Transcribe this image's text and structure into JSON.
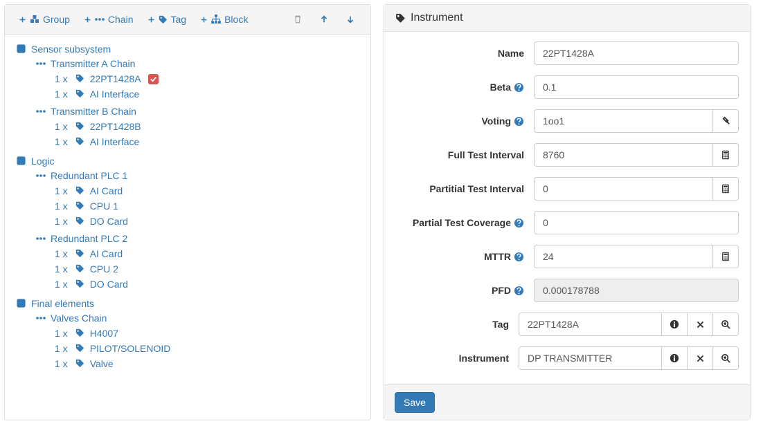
{
  "toolbar": {
    "group": "Group",
    "chain": "Chain",
    "tag": "Tag",
    "block": "Block"
  },
  "tree": {
    "groups": [
      {
        "label": "Sensor subsystem",
        "chains": [
          {
            "label": "Transmitter A Chain",
            "items": [
              {
                "qty": "1 x",
                "label": "22PT1428A",
                "selected": true
              },
              {
                "qty": "1 x",
                "label": "AI Interface"
              }
            ]
          },
          {
            "label": "Transmitter B Chain",
            "items": [
              {
                "qty": "1 x",
                "label": "22PT1428B"
              },
              {
                "qty": "1 x",
                "label": "AI Interface"
              }
            ]
          }
        ]
      },
      {
        "label": "Logic",
        "chains": [
          {
            "label": "Redundant PLC 1",
            "items": [
              {
                "qty": "1 x",
                "label": "AI Card"
              },
              {
                "qty": "1 x",
                "label": "CPU 1"
              },
              {
                "qty": "1 x",
                "label": "DO Card"
              }
            ]
          },
          {
            "label": "Redundant PLC 2",
            "items": [
              {
                "qty": "1 x",
                "label": "AI Card"
              },
              {
                "qty": "1 x",
                "label": "CPU 2"
              },
              {
                "qty": "1 x",
                "label": "DO Card"
              }
            ]
          }
        ]
      },
      {
        "label": "Final elements",
        "chains": [
          {
            "label": "Valves Chain",
            "items": [
              {
                "qty": "1 x",
                "label": "H4007"
              },
              {
                "qty": "1 x",
                "label": "PILOT/SOLENOID"
              },
              {
                "qty": "1 x",
                "label": "Valve"
              }
            ]
          }
        ]
      }
    ]
  },
  "detail": {
    "title": "Instrument",
    "fields": {
      "name_label": "Name",
      "name_value": "22PT1428A",
      "beta_label": "Beta",
      "beta_value": "0.1",
      "voting_label": "Voting",
      "voting_value": "1oo1",
      "fti_label": "Full Test Interval",
      "fti_value": "8760",
      "pti_label": "Partitial Test Interval",
      "pti_value": "0",
      "ptc_label": "Partial Test Coverage",
      "ptc_value": "0",
      "mttr_label": "MTTR",
      "mttr_value": "24",
      "pfd_label": "PFD",
      "pfd_value": "0.000178788",
      "tag_label": "Tag",
      "tag_value": "22PT1428A",
      "instrument_label": "Instrument",
      "instrument_value": "DP TRANSMITTER"
    },
    "save_label": "Save"
  }
}
